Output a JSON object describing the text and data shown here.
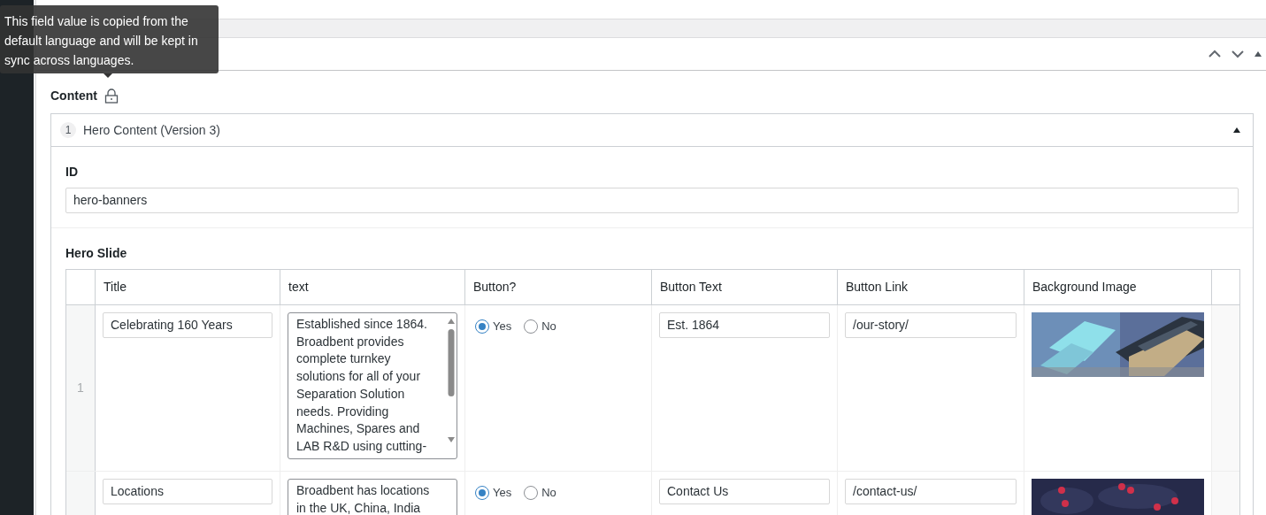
{
  "tooltip": {
    "text": "This field value is copied from the default language and will be kept in sync across languages."
  },
  "panel": {
    "expanded": true
  },
  "field": {
    "label": "Content",
    "locked": true
  },
  "layout": {
    "index": "1",
    "title": "Hero Content (Version 3)",
    "expanded": true
  },
  "id_field": {
    "label": "ID",
    "value": "hero-banners"
  },
  "repeater": {
    "label": "Hero Slide",
    "columns": [
      "Title",
      "text",
      "Button?",
      "Button Text",
      "Button Link",
      "Background Image"
    ],
    "rows": [
      {
        "index": "1",
        "title": "Celebrating 160 Years",
        "text": "Established since 1864. Broadbent provides complete turnkey solutions for all of your Separation Solution needs. Providing Machines, Spares and LAB R&D using cutting-",
        "scrollable": true,
        "options": [
          {
            "label": "Yes",
            "selected": true
          },
          {
            "label": "No",
            "selected": false
          }
        ],
        "button_text": "Est. 1864",
        "button_link": "/our-story/",
        "image": {
          "kind": "factory"
        }
      },
      {
        "title": "Locations",
        "text": "Broadbent has locations in the UK, China, India",
        "scrollable": false,
        "options": [
          {
            "label": "Yes",
            "selected": true
          },
          {
            "label": "No",
            "selected": false
          }
        ],
        "button_text": "Contact Us",
        "button_link": "/contact-us/",
        "image": {
          "kind": "map"
        }
      }
    ]
  }
}
